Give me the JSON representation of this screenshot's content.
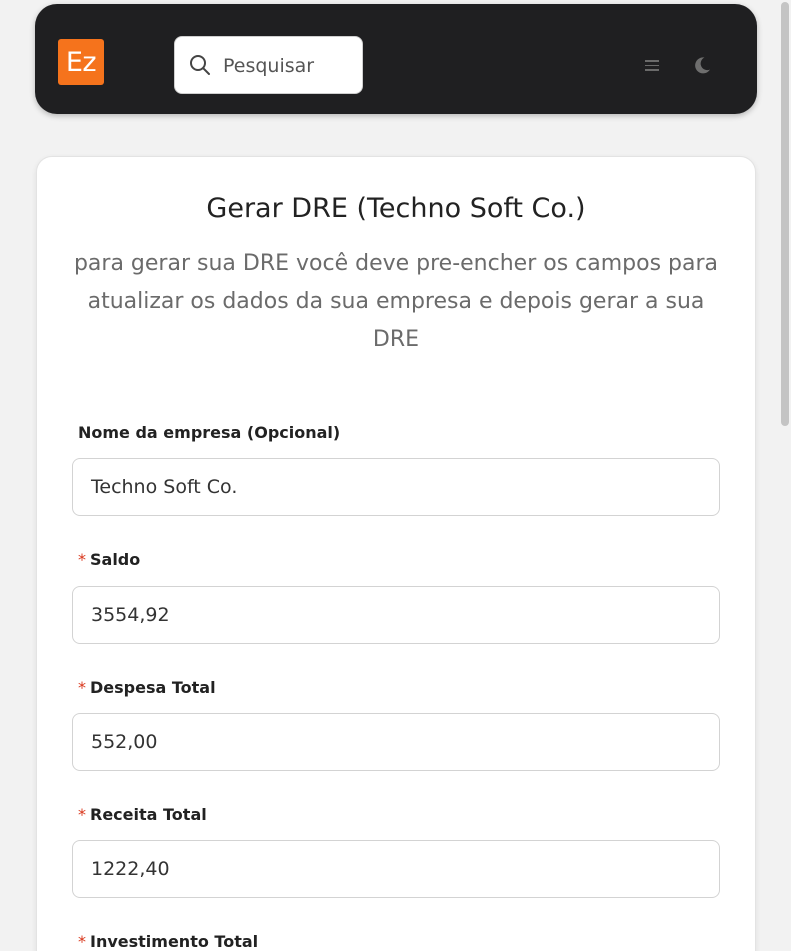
{
  "header": {
    "logo_text": "Ez",
    "logo_color": "#f5731c",
    "background": "#1f1f21",
    "search_placeholder": "Pesquisar",
    "icons": [
      "search-icon",
      "menu-icon",
      "moon-icon"
    ]
  },
  "card": {
    "title": "Gerar DRE (Techno Soft Co.)",
    "subtitle": "para gerar sua DRE você deve pre-encher os campos para atualizar os dados da sua empresa e depois gerar a sua DRE"
  },
  "form": {
    "required_mark": "*",
    "fields": [
      {
        "label": "Nome da empresa (Opcional)",
        "value": "Techno Soft Co.",
        "required": false
      },
      {
        "label": "Saldo",
        "value": "3554,92",
        "required": true
      },
      {
        "label": "Despesa Total",
        "value": "552,00",
        "required": true
      },
      {
        "label": "Receita Total",
        "value": "1222,40",
        "required": true
      },
      {
        "label": "Investimento Total",
        "value": "",
        "required": true
      }
    ]
  },
  "colors": {
    "required": "#d9361b",
    "page_background": "#f2f2f2"
  }
}
